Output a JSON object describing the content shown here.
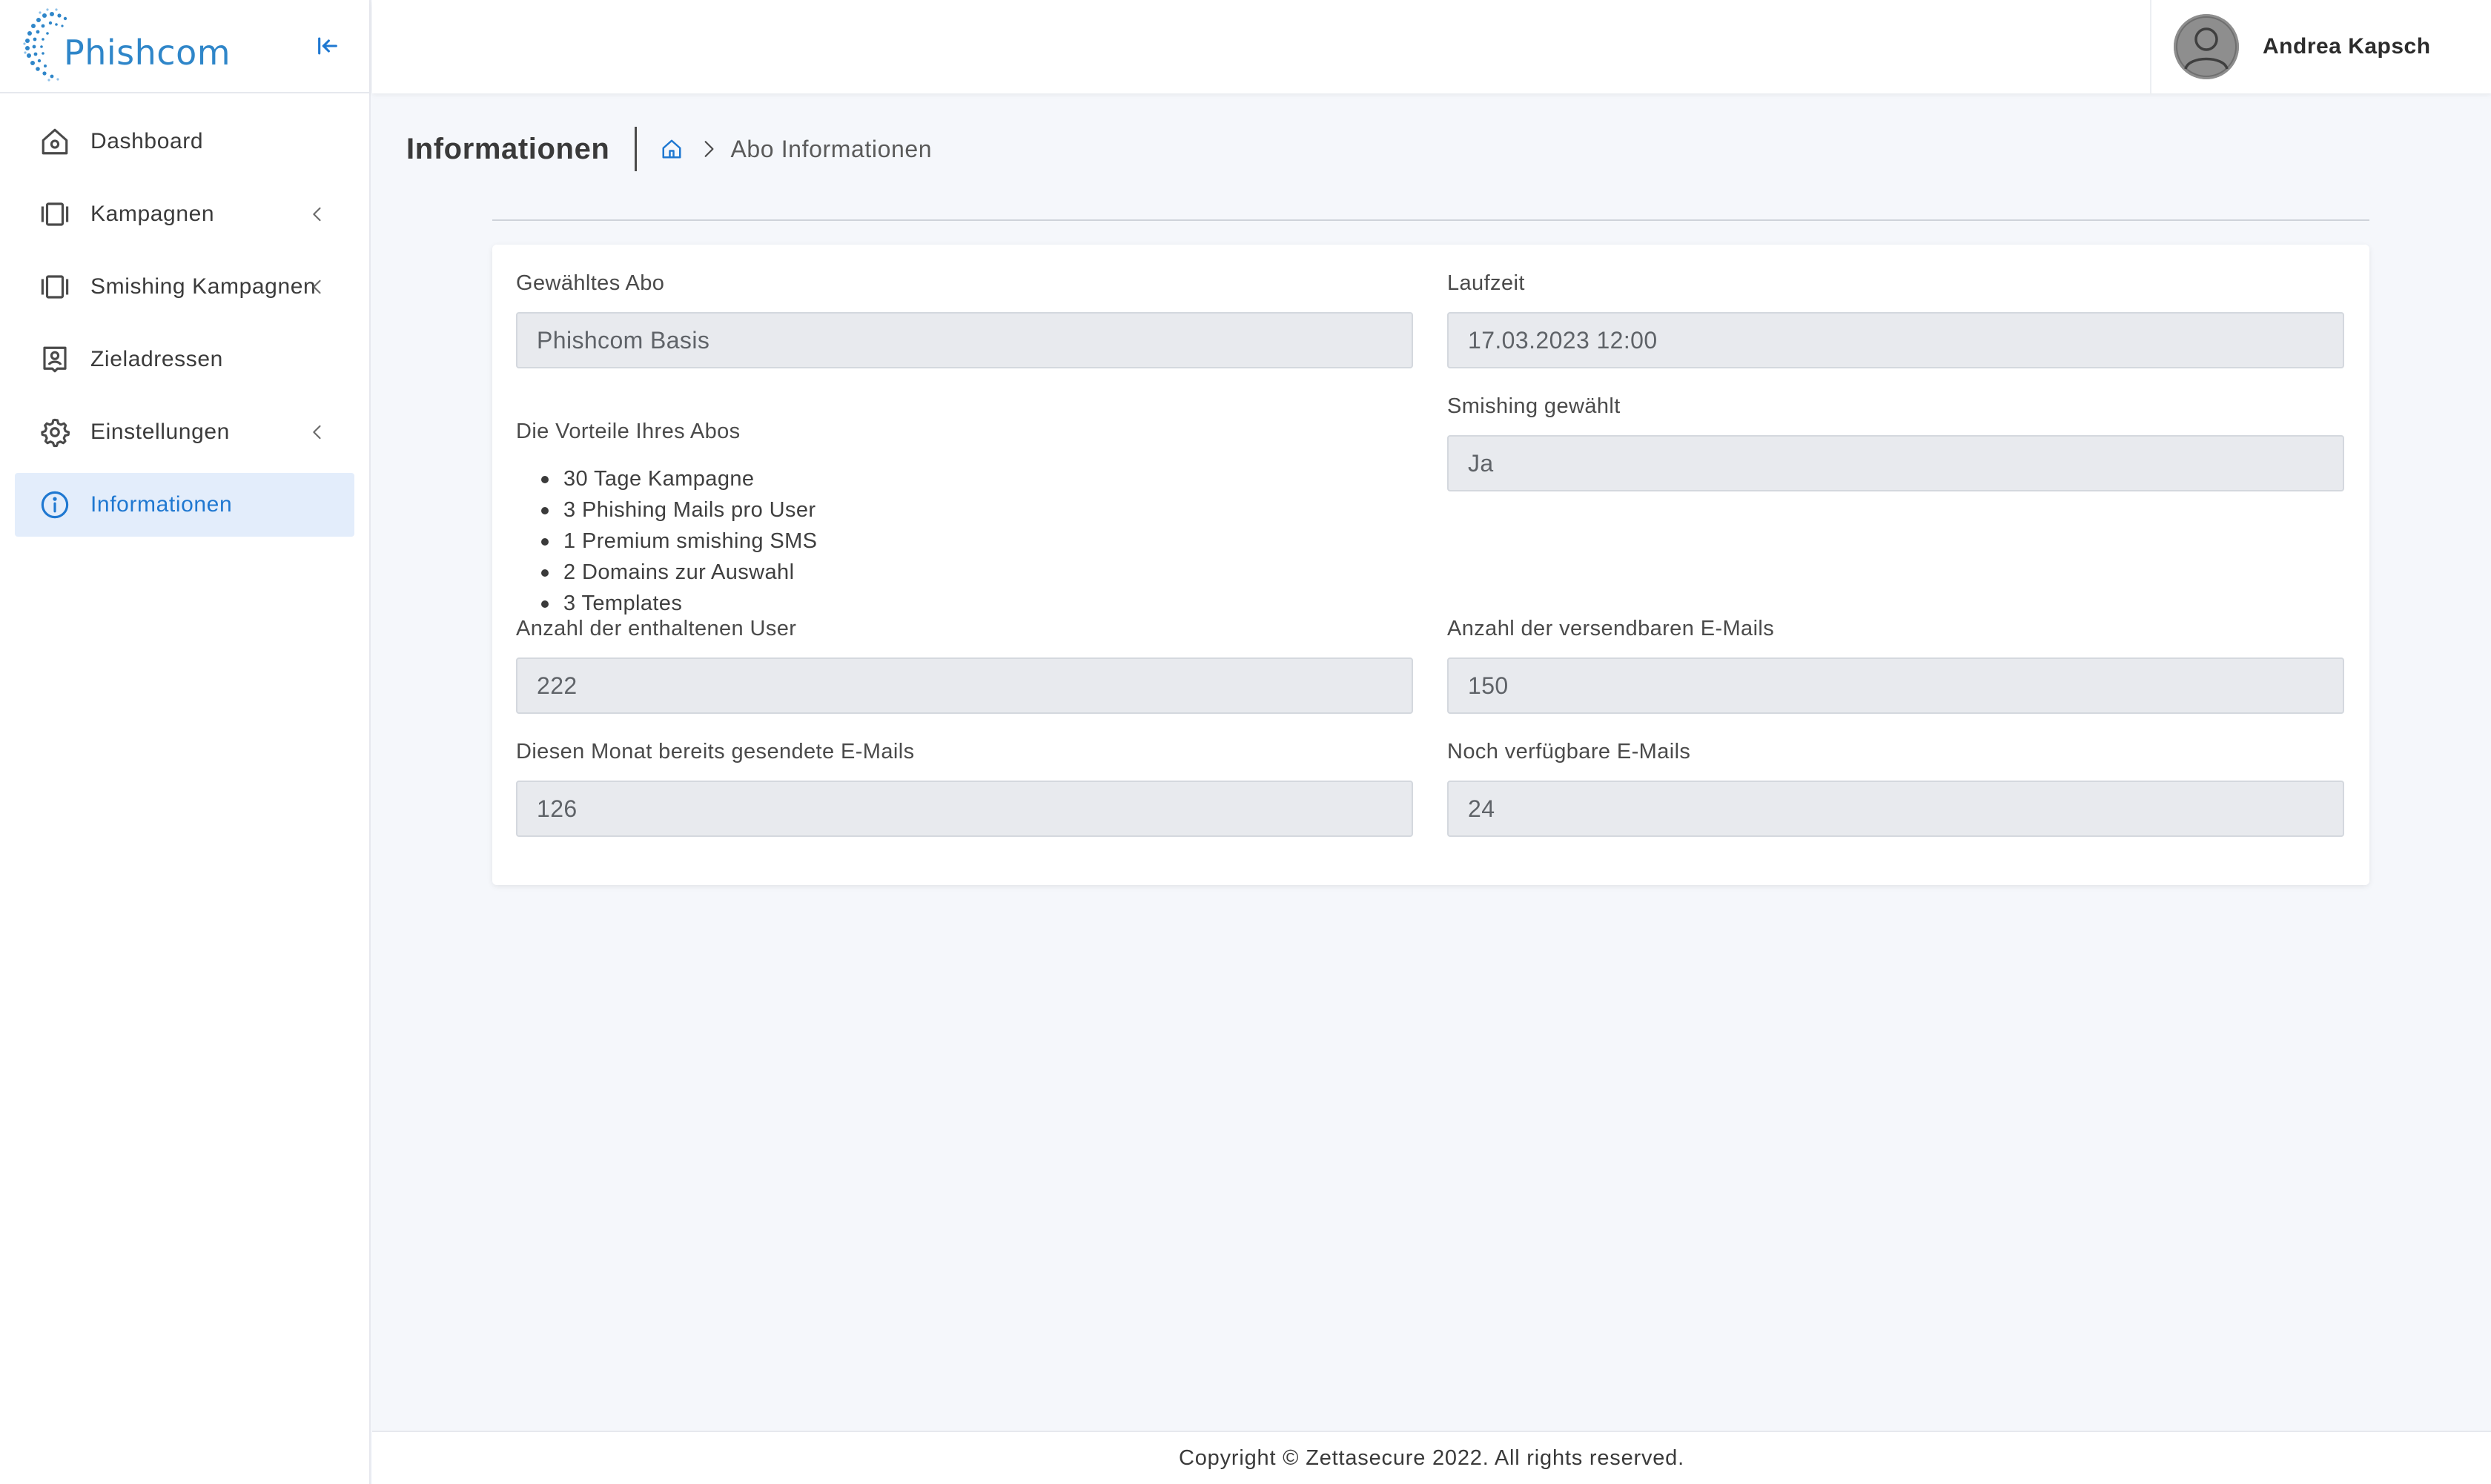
{
  "app": {
    "brand": "Phishcom",
    "accent_color": "#1f78d1"
  },
  "sidebar": {
    "collapse_icon": "collapse-left-icon",
    "items": [
      {
        "label": "Dashboard",
        "icon": "home-icon",
        "has_submenu": false,
        "active": false
      },
      {
        "label": "Kampagnen",
        "icon": "campaign-icon",
        "has_submenu": true,
        "active": false
      },
      {
        "label": "Smishing Kampagnen",
        "icon": "campaign-icon",
        "has_submenu": true,
        "active": false
      },
      {
        "label": "Zieladressen",
        "icon": "contact-icon",
        "has_submenu": false,
        "active": false
      },
      {
        "label": "Einstellungen",
        "icon": "gear-icon",
        "has_submenu": true,
        "active": false
      },
      {
        "label": "Informationen",
        "icon": "info-icon",
        "has_submenu": false,
        "active": true
      }
    ]
  },
  "header": {
    "user_name": "Andrea Kapsch"
  },
  "page": {
    "title": "Informationen",
    "breadcrumb_current": "Abo Informationen"
  },
  "form": {
    "abo": {
      "label": "Gewähltes Abo",
      "value": "Phishcom Basis"
    },
    "laufzeit": {
      "label": "Laufzeit",
      "value": "17.03.2023 12:00"
    },
    "vorteile": {
      "label": "Die Vorteile Ihres Abos",
      "items": [
        "30 Tage Kampagne",
        "3 Phishing Mails pro User",
        "1 Premium smishing SMS",
        "2 Domains zur Auswahl",
        "3 Templates"
      ]
    },
    "smishing": {
      "label": "Smishing gewählt",
      "value": "Ja"
    },
    "anzahl_user": {
      "label": "Anzahl der enthaltenen User",
      "value": "222"
    },
    "anzahl_mails": {
      "label": "Anzahl der versendbaren E-Mails",
      "value": "150"
    },
    "gesendet": {
      "label": "Diesen Monat bereits gesendete E-Mails",
      "value": "126"
    },
    "verfuegbar": {
      "label": "Noch verfügbare E-Mails",
      "value": "24"
    }
  },
  "footer": {
    "copyright": "Copyright © Zettasecure 2022. All rights reserved."
  }
}
